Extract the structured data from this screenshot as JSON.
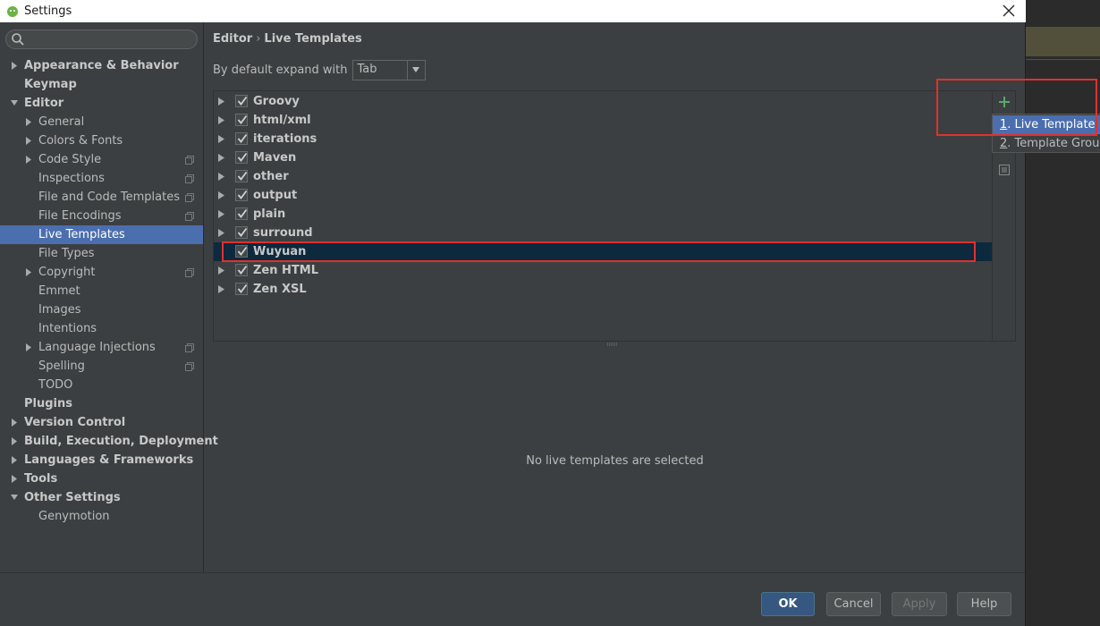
{
  "window": {
    "title": "Settings"
  },
  "sidebar": {
    "search_placeholder": "",
    "items": [
      {
        "label": "Appearance & Behavior",
        "level": 0,
        "arrow": "right",
        "bold": true,
        "proj": false
      },
      {
        "label": "Keymap",
        "level": 0,
        "arrow": "none",
        "bold": true,
        "proj": false
      },
      {
        "label": "Editor",
        "level": 0,
        "arrow": "down",
        "bold": true,
        "proj": false
      },
      {
        "label": "General",
        "level": 1,
        "arrow": "right",
        "bold": false,
        "proj": false
      },
      {
        "label": "Colors & Fonts",
        "level": 1,
        "arrow": "right",
        "bold": false,
        "proj": false
      },
      {
        "label": "Code Style",
        "level": 1,
        "arrow": "right",
        "bold": false,
        "proj": true
      },
      {
        "label": "Inspections",
        "level": 1,
        "arrow": "none",
        "bold": false,
        "proj": true
      },
      {
        "label": "File and Code Templates",
        "level": 1,
        "arrow": "none",
        "bold": false,
        "proj": true
      },
      {
        "label": "File Encodings",
        "level": 1,
        "arrow": "none",
        "bold": false,
        "proj": true
      },
      {
        "label": "Live Templates",
        "level": 1,
        "arrow": "none",
        "bold": false,
        "proj": false,
        "selected": true
      },
      {
        "label": "File Types",
        "level": 1,
        "arrow": "none",
        "bold": false,
        "proj": false
      },
      {
        "label": "Copyright",
        "level": 1,
        "arrow": "right",
        "bold": false,
        "proj": true
      },
      {
        "label": "Emmet",
        "level": 1,
        "arrow": "none",
        "bold": false,
        "proj": false
      },
      {
        "label": "Images",
        "level": 1,
        "arrow": "none",
        "bold": false,
        "proj": false
      },
      {
        "label": "Intentions",
        "level": 1,
        "arrow": "none",
        "bold": false,
        "proj": false
      },
      {
        "label": "Language Injections",
        "level": 1,
        "arrow": "right",
        "bold": false,
        "proj": true
      },
      {
        "label": "Spelling",
        "level": 1,
        "arrow": "none",
        "bold": false,
        "proj": true
      },
      {
        "label": "TODO",
        "level": 1,
        "arrow": "none",
        "bold": false,
        "proj": false
      },
      {
        "label": "Plugins",
        "level": 0,
        "arrow": "none",
        "bold": true,
        "proj": false
      },
      {
        "label": "Version Control",
        "level": 0,
        "arrow": "right",
        "bold": true,
        "proj": false
      },
      {
        "label": "Build, Execution, Deployment",
        "level": 0,
        "arrow": "right",
        "bold": true,
        "proj": false
      },
      {
        "label": "Languages & Frameworks",
        "level": 0,
        "arrow": "right",
        "bold": true,
        "proj": false
      },
      {
        "label": "Tools",
        "level": 0,
        "arrow": "right",
        "bold": true,
        "proj": false
      },
      {
        "label": "Other Settings",
        "level": 0,
        "arrow": "down",
        "bold": true,
        "proj": false
      },
      {
        "label": "Genymotion",
        "level": 1,
        "arrow": "none",
        "bold": false,
        "proj": false
      }
    ]
  },
  "main": {
    "breadcrumb": {
      "parent": "Editor",
      "separator": "›",
      "current": "Live Templates"
    },
    "expand_label": "By default expand with",
    "expand_value": "Tab",
    "template_groups": [
      {
        "label": "Groovy",
        "checked": true
      },
      {
        "label": "html/xml",
        "checked": true
      },
      {
        "label": "iterations",
        "checked": true
      },
      {
        "label": "Maven",
        "checked": true
      },
      {
        "label": "other",
        "checked": true
      },
      {
        "label": "output",
        "checked": true
      },
      {
        "label": "plain",
        "checked": true
      },
      {
        "label": "surround",
        "checked": true
      },
      {
        "label": "Wuyuan",
        "checked": true,
        "selected": true
      },
      {
        "label": "Zen HTML",
        "checked": true
      },
      {
        "label": "Zen XSL",
        "checked": true
      }
    ],
    "empty_message": "No live templates are selected"
  },
  "popup": {
    "items": [
      {
        "mnemonic": "1",
        "text": ". Live Template",
        "active": true
      },
      {
        "mnemonic": "2",
        "text": ". Template Group...",
        "active": false
      }
    ]
  },
  "footer": {
    "ok": "OK",
    "cancel": "Cancel",
    "apply": "Apply",
    "help": "Help"
  },
  "colors": {
    "accent": "#4b6eaf",
    "add_icon": "#59a869",
    "highlight_box": "#e0312e",
    "selected_row": "#0d293e"
  }
}
